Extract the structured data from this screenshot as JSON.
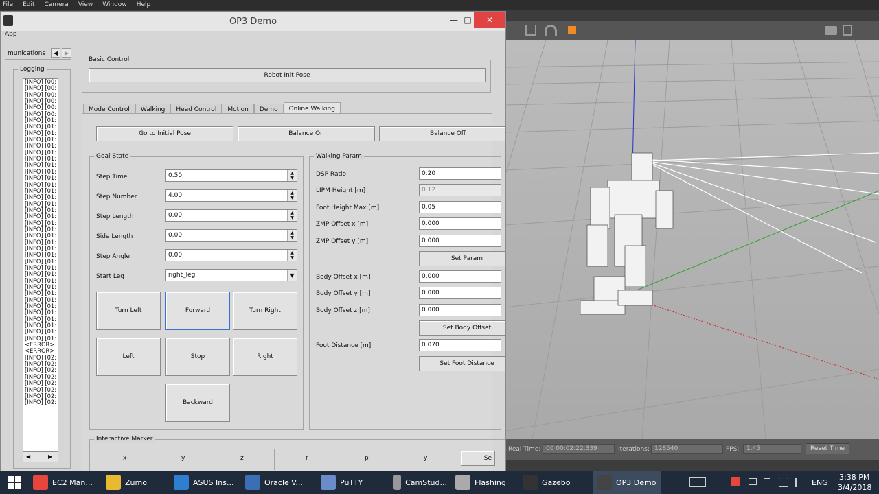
{
  "gazebo": {
    "menu": [
      "File",
      "Edit",
      "Camera",
      "View",
      "Window",
      "Help"
    ],
    "status": {
      "real_time_label": "Real Time:",
      "real_time_value": "00 00:02:22.339",
      "iterations_label": "Iterations:",
      "iterations_value": "128540",
      "fps_label": "FPS:",
      "fps_value": "1.45",
      "reset_label": "Reset Time"
    }
  },
  "window": {
    "title": "OP3 Demo",
    "menu": "App"
  },
  "left_panel": {
    "tab_label": "munications",
    "logging_title": "Logging",
    "log_lines": [
      "[INFO] [00:",
      "[INFO] [00:",
      "[INFO] [00:",
      "[INFO] [00:",
      "[INFO] [00:",
      "[INFO] [00:",
      "[INFO] [01:",
      "[INFO] [01:",
      "[INFO] [01:",
      "[INFO] [01:",
      "[INFO] [01:",
      "[INFO] [01:",
      "[INFO] [01:",
      "[INFO] [01:",
      "[INFO] [01:",
      "[INFO] [01:",
      "[INFO] [01:",
      "[INFO] [01:",
      "[INFO] [01:",
      "[INFO] [01:",
      "[INFO] [01:",
      "[INFO] [01:",
      "[INFO] [01:",
      "[INFO] [01:",
      "[INFO] [01:",
      "[INFO] [01:",
      "[INFO] [01:",
      "[INFO] [01:",
      "[INFO] [01:",
      "[INFO] [01:",
      "[INFO] [01:",
      "[INFO] [01:",
      "[INFO] [01:",
      "[INFO] [01:",
      "[INFO] [01:",
      "[INFO] [01:",
      "[INFO] [01:",
      "[INFO] [01:",
      "[INFO] [01:",
      "[INFO] [01:",
      "[INFO] [01:",
      "<ERROR>",
      "<ERROR>",
      "[INFO] [02:",
      "[INFO] [02:",
      "[INFO] [02:",
      "[INFO] [02:",
      "[INFO] [02:",
      "[INFO] [02:",
      "[INFO] [02:",
      "[INFO] [02:"
    ]
  },
  "basic_control": {
    "title": "Basic Control",
    "robot_init_pose": "Robot Init Pose"
  },
  "tabs": [
    "Mode Control",
    "Walking",
    "Head Control",
    "Motion",
    "Demo",
    "Online Walking"
  ],
  "online_walking": {
    "go_initial": "Go to Initial Pose",
    "balance_on": "Balance On",
    "balance_off": "Balance Off",
    "goal_state": {
      "title": "Goal State",
      "step_time_label": "Step Time",
      "step_time": "0.50",
      "step_number_label": "Step Number",
      "step_number": "4.00",
      "step_length_label": "Step Length",
      "step_length": "0.00",
      "side_length_label": "Side Length",
      "side_length": "0.00",
      "step_angle_label": "Step Angle",
      "step_angle": "0.00",
      "start_leg_label": "Start Leg",
      "start_leg": "right_leg",
      "turn_left": "Turn Left",
      "forward": "Forward",
      "turn_right": "Turn Right",
      "left": "Left",
      "stop": "Stop",
      "right": "Right",
      "backward": "Backward"
    },
    "walking_param": {
      "title": "Walking Param",
      "dsp_label": "DSP Ratio",
      "dsp": "0.20",
      "lipm_label": "LIPM Height [m]",
      "lipm": "0.12",
      "foot_height_label": "Foot Height Max [m]",
      "foot_height": "0.05",
      "zmp_x_label": "ZMP Offset x [m]",
      "zmp_x": "0.000",
      "zmp_y_label": "ZMP Offset y [m]",
      "zmp_y": "0.000",
      "set_param": "Set Param",
      "body_x_label": "Body Offset x [m]",
      "body_x": "0.000",
      "body_y_label": "Body Offset y [m]",
      "body_y": "0.000",
      "body_z_label": "Body Offset z [m]",
      "body_z": "0.000",
      "set_body_offset": "Set Body Offset",
      "foot_distance_label": "Foot Distance [m]",
      "foot_distance": "0.070",
      "set_foot_distance": "Set Foot Distance"
    },
    "interactive_marker": {
      "title": "Interactive Marker",
      "cols": [
        "x",
        "y",
        "z",
        "r",
        "p",
        "y"
      ],
      "set_label": "Se"
    }
  },
  "taskbar": {
    "items": [
      {
        "label": "EC2 Man...",
        "color": "#e8453c"
      },
      {
        "label": "Zumo",
        "color": "#e8b931"
      },
      {
        "label": "ASUS Ins...",
        "color": "#2f7fd1"
      },
      {
        "label": "Oracle V...",
        "color": "#3a6fb5"
      },
      {
        "label": "PuTTY",
        "color": "#6a8cc9"
      },
      {
        "label": "CamStud...",
        "color": "#999999"
      },
      {
        "label": "Flashing",
        "color": "#aaaaaa"
      },
      {
        "label": "Gazebo",
        "color": "#333333"
      },
      {
        "label": "OP3 Demo",
        "color": "#444444"
      }
    ],
    "lang": "ENG",
    "time": "3:38 PM",
    "date": "3/4/2018"
  }
}
